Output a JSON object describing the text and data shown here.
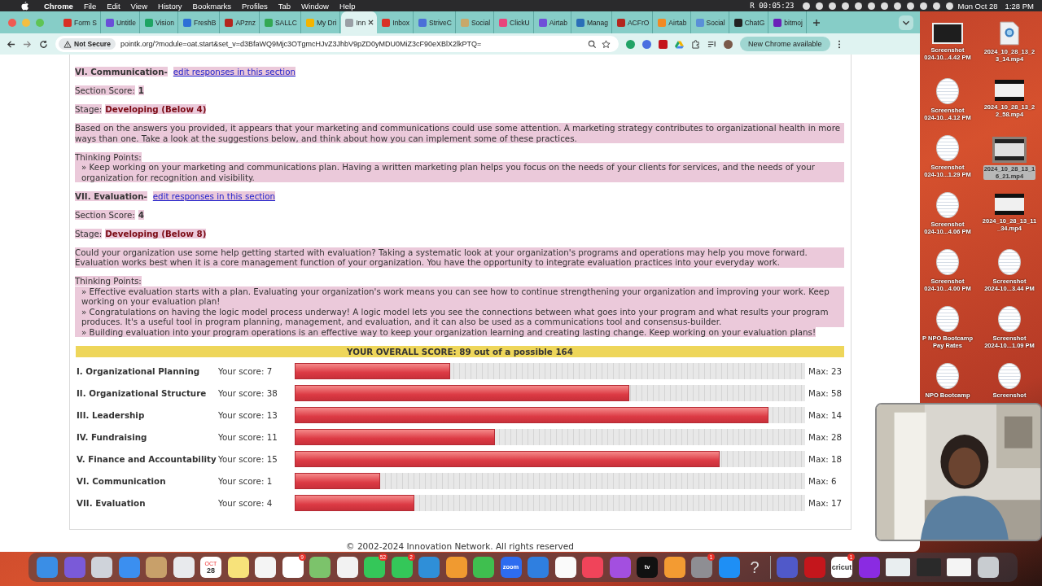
{
  "menu_bar": {
    "app": "Chrome",
    "menus": [
      "File",
      "Edit",
      "View",
      "History",
      "Bookmarks",
      "Profiles",
      "Tab",
      "Window",
      "Help"
    ],
    "recording": "R 00:05:23",
    "date": "Mon Oct 28",
    "time": "1:28 PM"
  },
  "browser": {
    "tabs": [
      {
        "title": "Form S",
        "selected": false,
        "color": "#d93025"
      },
      {
        "title": "Untitle",
        "selected": false,
        "color": "#6a4fd8"
      },
      {
        "title": "Vision",
        "selected": false,
        "color": "#1fa463"
      },
      {
        "title": "FreshB",
        "selected": false,
        "color": "#2c6fd6"
      },
      {
        "title": "APznz",
        "selected": false,
        "color": "#b3261e"
      },
      {
        "title": "SALLC",
        "selected": false,
        "color": "#34a853"
      },
      {
        "title": "My Dri",
        "selected": false,
        "color": "#f4b400"
      },
      {
        "title": "Inn",
        "selected": true,
        "color": "#9aa0a6"
      },
      {
        "title": "Inbox",
        "selected": false,
        "color": "#d93025"
      },
      {
        "title": "StriveC",
        "selected": false,
        "color": "#4a6fd8"
      },
      {
        "title": "Social",
        "selected": false,
        "color": "#c7a86a"
      },
      {
        "title": "ClickU",
        "selected": false,
        "color": "#e8457c"
      },
      {
        "title": "Airtab",
        "selected": false,
        "color": "#6f4fd8"
      },
      {
        "title": "Manag",
        "selected": false,
        "color": "#2a6fb8"
      },
      {
        "title": "ACFrO",
        "selected": false,
        "color": "#b3261e"
      },
      {
        "title": "Airtab",
        "selected": false,
        "color": "#f08a24"
      },
      {
        "title": "Social",
        "selected": false,
        "color": "#5a8fd8"
      },
      {
        "title": "ChatG",
        "selected": false,
        "color": "#222222"
      },
      {
        "title": "bitmoj",
        "selected": false,
        "color": "#6a1fb8"
      }
    ],
    "address": {
      "security": "Not Secure",
      "url": "pointk.org/?module=oat.start&set_v=d3BfaWQ9Mjc3OTgmcHJvZ3JhbV9pZD0yMDU0MiZ3cF90eXBlX2lkPTQ="
    },
    "update_button": "New Chrome available"
  },
  "page": {
    "sections": [
      {
        "heading": "VI. Communication-",
        "edit_link": "edit responses in this section",
        "score_label": "Section Score:",
        "score": "1",
        "stage_label": "Stage:",
        "stage": "Developing (Below 4)",
        "summary": "Based on the answers you provided, it appears that your marketing and communications could use some attention. A marketing strategy contributes to organizational health in more ways than one. Take a look at the suggestions below, and think about how you can implement some of these practices.",
        "thinking_label": "Thinking Points:",
        "points": [
          "» Keep working on your marketing and communications plan. Having a written marketing plan helps you focus on the needs of your clients for services, and the needs of your organization for recognition and visibility."
        ]
      },
      {
        "heading": "VII. Evaluation-",
        "edit_link": "edit responses in this section",
        "score_label": "Section Score:",
        "score": "4",
        "stage_label": "Stage:",
        "stage": "Developing (Below 8)",
        "summary": "Could your organization use some help getting started with evaluation? Taking a systematic look at your organization's programs and operations may help you move forward. Evaluation works best when it is a core management function of your organization. You have the opportunity to integrate evaluation practices into your everyday work.",
        "thinking_label": "Thinking Points:",
        "points": [
          "» Effective evaluation starts with a plan. Evaluating your organization's work means you can see how to continue strengthening your organization and improving your work. Keep working on your evaluation plan!",
          "» Congratulations on having the logic model process underway! A logic model lets you see the connections between what goes into your program and what results your program produces. It's a useful tool in program planning, management, and evaluation, and it can also be used as a communications tool and consensus-builder.",
          "» Building evaluation into your program operations is an effective way to keep your organization learning and creating lasting change. Keep working on your evaluation plans!"
        ]
      }
    ],
    "overall": "YOUR OVERALL SCORE: 89 out of a possible 164",
    "scores": [
      {
        "name": "I. Organizational Planning",
        "score": "Your score: 7",
        "level": 0.304,
        "max": "Max: 23"
      },
      {
        "name": "II. Organizational Structure",
        "score": "Your score: 38",
        "level": 0.655,
        "max": "Max: 58"
      },
      {
        "name": "III. Leadership",
        "score": "Your score: 13",
        "level": 0.929,
        "max": "Max: 14"
      },
      {
        "name": "IV. Fundraising",
        "score": "Your score: 11",
        "level": 0.393,
        "max": "Max: 28"
      },
      {
        "name": "V. Finance and Accountability",
        "score": "Your score: 15",
        "level": 0.833,
        "max": "Max: 18"
      },
      {
        "name": "VI. Communication",
        "score": "Your score: 1",
        "level": 0.167,
        "max": "Max: 6"
      },
      {
        "name": "VII. Evaluation",
        "score": "Your score: 4",
        "level": 0.235,
        "max": "Max: 17"
      }
    ],
    "footer": "© 2002-2024 Innovation Network. All rights reserved"
  },
  "desktop": {
    "icons": [
      {
        "lines": [
          "Screenshot",
          "024-10...4.42 PM"
        ],
        "kind": "dark",
        "selected": false
      },
      {
        "lines": [
          "2024_10_28_13_2",
          "3_14.mp4"
        ],
        "kind": "file",
        "selected": false
      },
      {
        "lines": [
          "Screenshot",
          "024-10...4.12 PM"
        ],
        "kind": "light",
        "selected": false
      },
      {
        "lines": [
          "2024_10_28_13_2",
          "2_58.mp4"
        ],
        "kind": "video",
        "selected": false
      },
      {
        "lines": [
          "Screenshot",
          "024-10...1.29 PM"
        ],
        "kind": "light",
        "selected": false
      },
      {
        "lines": [
          "2024_10_28_13_1",
          "6_21.mp4"
        ],
        "kind": "video",
        "selected": true
      },
      {
        "lines": [
          "Screenshot",
          "024-10...4.06 PM"
        ],
        "kind": "light",
        "selected": false
      },
      {
        "lines": [
          "2024_10_28_13_11",
          "_34.mp4"
        ],
        "kind": "video",
        "selected": false
      },
      {
        "lines": [
          "Screenshot",
          "024-10...4.00 PM"
        ],
        "kind": "light",
        "selected": false
      },
      {
        "lines": [
          "Screenshot",
          "2024-10...3.44 PM"
        ],
        "kind": "light",
        "selected": false
      },
      {
        "lines": [
          "P NPO Bootcamp",
          "Pay Rates"
        ],
        "kind": "light",
        "selected": false
      },
      {
        "lines": [
          "Screenshot",
          "2024-10...1.09 PM"
        ],
        "kind": "light",
        "selected": false
      },
      {
        "lines": [
          "NPO Bootcamp"
        ],
        "kind": "light",
        "selected": false
      },
      {
        "lines": [
          "Screenshot"
        ],
        "kind": "light",
        "selected": false
      }
    ]
  },
  "dock": {
    "items": [
      {
        "kind": "app",
        "color": "#3a8ee6"
      },
      {
        "kind": "app",
        "color": "#7a5ad8"
      },
      {
        "kind": "app",
        "color": "#cfd3da"
      },
      {
        "kind": "app",
        "color": "#3b8ff0"
      },
      {
        "kind": "app",
        "color": "#c8a06a"
      },
      {
        "kind": "app",
        "color": "#e8eaed"
      },
      {
        "kind": "app",
        "color": "#ffffff",
        "caption": "OCT",
        "label": "28"
      },
      {
        "kind": "app",
        "color": "#f7e27a"
      },
      {
        "kind": "app",
        "color": "#f4f4f4"
      },
      {
        "kind": "app",
        "color": "#ffffff",
        "badge": "9"
      },
      {
        "kind": "app",
        "color": "#7cc36b"
      },
      {
        "kind": "app",
        "color": "#f2f2f2"
      },
      {
        "kind": "app",
        "color": "#34c759",
        "badge": "52"
      },
      {
        "kind": "app",
        "color": "#34c759",
        "badge": "2"
      },
      {
        "kind": "app",
        "color": "#2f8fd8"
      },
      {
        "kind": "app",
        "color": "#f09a30"
      },
      {
        "kind": "app",
        "color": "#3fbf4f"
      },
      {
        "kind": "app",
        "color": "#2d6cf0",
        "label": "zoom"
      },
      {
        "kind": "app",
        "color": "#2f7fe0"
      },
      {
        "kind": "app",
        "color": "#fafafa"
      },
      {
        "kind": "app",
        "color": "#f0445a"
      },
      {
        "kind": "app",
        "color": "#a34fe0"
      },
      {
        "kind": "app",
        "color": "#111111",
        "label": "tv"
      },
      {
        "kind": "app",
        "color": "#f39b32"
      },
      {
        "kind": "app",
        "color": "#8e8e93",
        "badge": "1"
      },
      {
        "kind": "app",
        "color": "#1e8ff5"
      },
      {
        "kind": "help",
        "label": "?"
      },
      {
        "kind": "separator"
      },
      {
        "kind": "app",
        "color": "#5059c9"
      },
      {
        "kind": "app",
        "color": "#c4161c"
      },
      {
        "kind": "app",
        "color": "#ffffff",
        "label": "cricut",
        "badge": "1"
      },
      {
        "kind": "app",
        "color": "#8a2be2"
      },
      {
        "kind": "thumbnail",
        "color": "#e9eef0"
      },
      {
        "kind": "thumbnail",
        "color": "#2a2a2a"
      },
      {
        "kind": "thumbnail",
        "color": "#f4f4f4"
      },
      {
        "kind": "app",
        "color": "#c8ccd0"
      }
    ]
  }
}
